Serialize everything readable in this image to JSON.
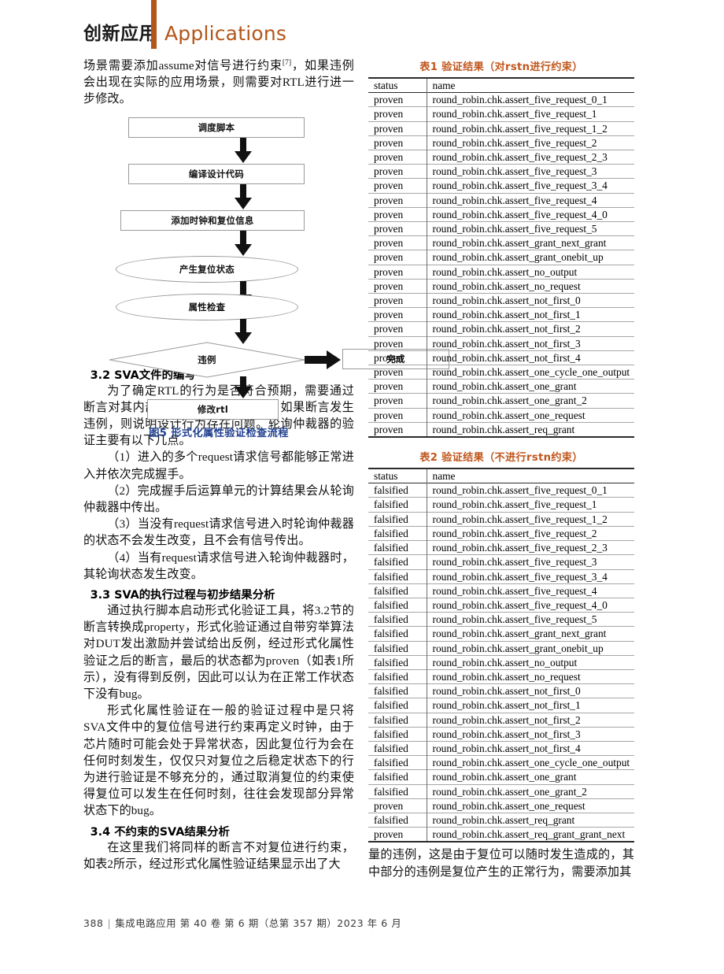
{
  "header": {
    "cn_title": "创新应用",
    "en_title": "Applications",
    "accent_color": "#b4561a"
  },
  "left_column": {
    "intro_paragraph": "场景需要添加assume对信号进行约束[7]，如果违例会出现在实际的应用场景，则需要对RTL进行进一步修改。",
    "intro_text_a": "场景需要添加assume对信号进行约束",
    "intro_sup": "[7]",
    "intro_text_b": "，如果违例会出现在实际的应用场景，则需要对RTL进行进一步修改。",
    "figure": {
      "caption": "图5  形式化属性验证检查流程",
      "caption_color": "#1f3f8f",
      "nodes": [
        {
          "id": "n1",
          "shape": "rect",
          "label": "调度脚本"
        },
        {
          "id": "n2",
          "shape": "rect",
          "label": "编译设计代码"
        },
        {
          "id": "n3",
          "shape": "rect",
          "label": "添加时钟和复位信息"
        },
        {
          "id": "n4",
          "shape": "ellipse",
          "label": "产生复位状态"
        },
        {
          "id": "n5",
          "shape": "ellipse",
          "label": "属性检查"
        },
        {
          "id": "n6",
          "shape": "diamond",
          "label": "违例"
        },
        {
          "id": "n7",
          "shape": "rect",
          "label": "完成"
        },
        {
          "id": "n8",
          "shape": "rect",
          "label": "修改rtl"
        }
      ]
    },
    "sections": [
      {
        "heading": "3.2 SVA文件的编写",
        "paragraphs": [
          "为了确定RTL的行为是否符合预期，需要通过断言对其内部信号的行为进行判断，如果断言发生违例，则说明设计行为存在问题。轮询仲裁器的验证主要有以下几点。",
          "（1）进入的多个request请求信号都能够正常进入并依次完成握手。",
          "（2）完成握手后运算单元的计算结果会从轮询仲裁器中传出。",
          "（3）当没有request请求信号进入时轮询仲裁器的状态不会发生改变，且不会有信号传出。",
          "（4）当有request请求信号进入轮询仲裁器时，其轮询状态发生改变。"
        ]
      },
      {
        "heading": "3.3 SVA的执行过程与初步结果分析",
        "paragraphs": [
          "通过执行脚本启动形式化验证工具，将3.2节的断言转换成property，形式化验证通过自带穷举算法对DUT发出激励并尝试给出反例，经过形式化属性验证之后的断言，最后的状态都为proven（如表1所示），没有得到反例，因此可以认为在正常工作状态下没有bug。",
          "形式化属性验证在一般的验证过程中是只将SVA文件中的复位信号进行约束再定义时钟，由于芯片随时可能会处于异常状态，因此复位行为会在任何时刻发生，仅仅只对复位之后稳定状态下的行为进行验证是不够充分的，通过取消复位的约束使得复位可以发生在任何时刻，往往会发现部分异常状态下的bug。"
        ]
      },
      {
        "heading": "3.4 不约束的SVA结果分析",
        "paragraphs": [
          "在这里我们将同样的断言不对复位进行约束，如表2所示，经过形式化属性验证结果显示出了大"
        ]
      }
    ]
  },
  "right_column": {
    "table1": {
      "caption": "表1  验证结果（对rstn进行约束）",
      "caption_color": "#c0561c",
      "columns": [
        "status",
        "name"
      ],
      "rows": [
        [
          "proven",
          "round_robin.chk.assert_five_request_0_1"
        ],
        [
          "proven",
          "round_robin.chk.assert_five_request_1"
        ],
        [
          "proven",
          "round_robin.chk.assert_five_request_1_2"
        ],
        [
          "proven",
          "round_robin.chk.assert_five_request_2"
        ],
        [
          "proven",
          "round_robin.chk.assert_five_request_2_3"
        ],
        [
          "proven",
          "round_robin.chk.assert_five_request_3"
        ],
        [
          "proven",
          "round_robin.chk.assert_five_request_3_4"
        ],
        [
          "proven",
          "round_robin.chk.assert_five_request_4"
        ],
        [
          "proven",
          "round_robin.chk.assert_five_request_4_0"
        ],
        [
          "proven",
          "round_robin.chk.assert_five_request_5"
        ],
        [
          "proven",
          "round_robin.chk.assert_grant_next_grant"
        ],
        [
          "proven",
          "round_robin.chk.assert_grant_onebit_up"
        ],
        [
          "proven",
          "round_robin.chk.assert_no_output"
        ],
        [
          "proven",
          "round_robin.chk.assert_no_request"
        ],
        [
          "proven",
          "round_robin.chk.assert_not_first_0"
        ],
        [
          "proven",
          "round_robin.chk.assert_not_first_1"
        ],
        [
          "proven",
          "round_robin.chk.assert_not_first_2"
        ],
        [
          "proven",
          "round_robin.chk.assert_not_first_3"
        ],
        [
          "proven",
          "round_robin.chk.assert_not_first_4"
        ],
        [
          "proven",
          "round_robin.chk.assert_one_cycle_one_output"
        ],
        [
          "proven",
          "round_robin.chk.assert_one_grant"
        ],
        [
          "proven",
          "round_robin.chk.assert_one_grant_2"
        ],
        [
          "proven",
          "round_robin.chk.assert_one_request"
        ],
        [
          "proven",
          "round_robin.chk.assert_req_grant"
        ]
      ]
    },
    "table2": {
      "caption": "表2  验证结果（不进行rstn约束）",
      "caption_color": "#c0561c",
      "columns": [
        "status",
        "name"
      ],
      "rows": [
        [
          "falsified",
          "round_robin.chk.assert_five_request_0_1"
        ],
        [
          "falsified",
          "round_robin.chk.assert_five_request_1"
        ],
        [
          "falsified",
          "round_robin.chk.assert_five_request_1_2"
        ],
        [
          "falsified",
          "round_robin.chk.assert_five_request_2"
        ],
        [
          "falsified",
          "round_robin.chk.assert_five_request_2_3"
        ],
        [
          "falsified",
          "round_robin.chk.assert_five_request_3"
        ],
        [
          "falsified",
          "round_robin.chk.assert_five_request_3_4"
        ],
        [
          "falsified",
          "round_robin.chk.assert_five_request_4"
        ],
        [
          "falsified",
          "round_robin.chk.assert_five_request_4_0"
        ],
        [
          "falsified",
          "round_robin.chk.assert_five_request_5"
        ],
        [
          "falsified",
          "round_robin.chk.assert_grant_next_grant"
        ],
        [
          "falsified",
          "round_robin.chk.assert_grant_onebit_up"
        ],
        [
          "falsified",
          "round_robin.chk.assert_no_output"
        ],
        [
          "falsified",
          "round_robin.chk.assert_no_request"
        ],
        [
          "falsified",
          "round_robin.chk.assert_not_first_0"
        ],
        [
          "falsified",
          "round_robin.chk.assert_not_first_1"
        ],
        [
          "falsified",
          "round_robin.chk.assert_not_first_2"
        ],
        [
          "falsified",
          "round_robin.chk.assert_not_first_3"
        ],
        [
          "falsified",
          "round_robin.chk.assert_not_first_4"
        ],
        [
          "falsified",
          "round_robin.chk.assert_one_cycle_one_output"
        ],
        [
          "falsified",
          "round_robin.chk.assert_one_grant"
        ],
        [
          "falsified",
          "round_robin.chk.assert_one_grant_2"
        ],
        [
          "proven",
          "round_robin.chk.assert_one_request"
        ],
        [
          "falsified",
          "round_robin.chk.assert_req_grant"
        ],
        [
          "proven",
          "round_robin.chk.assert_req_grant_grant_next"
        ]
      ]
    },
    "closing_paragraph": "量的违例，这是由于复位可以随时发生造成的，其中部分的违例是复位产生的正常行为，需要添加其"
  },
  "footer": {
    "page_number": "388",
    "journal_line": "集成电路应用  第 40 卷 第 6 期（总第 357 期）2023 年 6 月"
  }
}
